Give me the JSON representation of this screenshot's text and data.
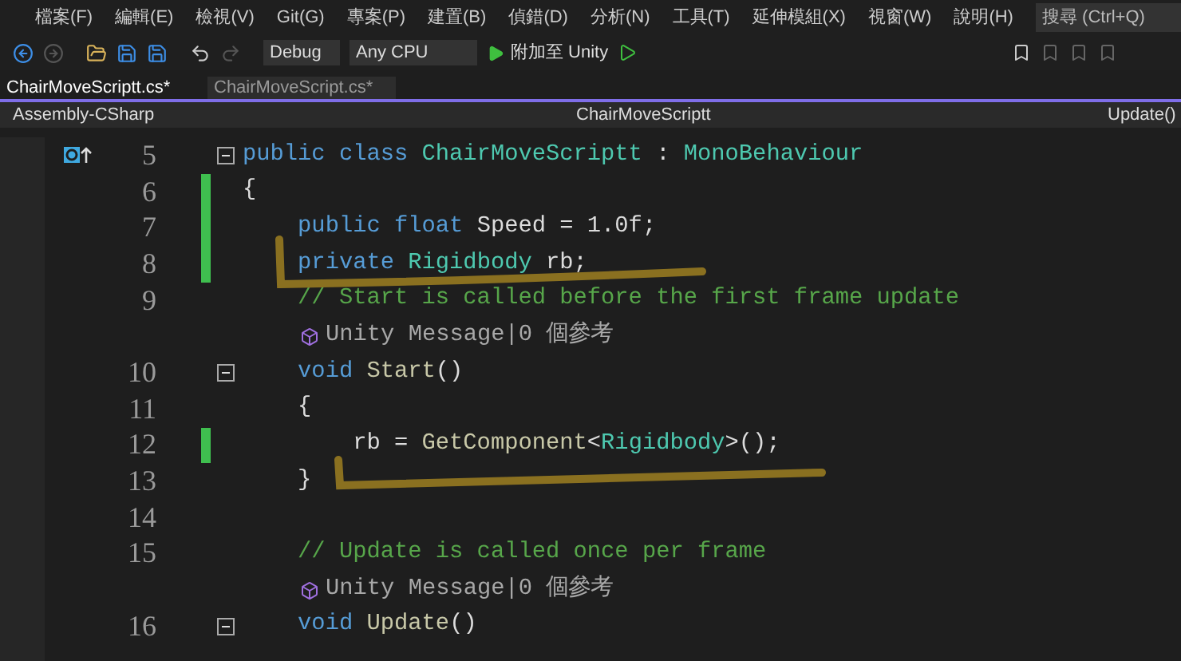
{
  "menu": [
    "檔案(F)",
    "編輯(E)",
    "檢視(V)",
    "Git(G)",
    "專案(P)",
    "建置(B)",
    "偵錯(D)",
    "分析(N)",
    "工具(T)",
    "延伸模組(X)",
    "視窗(W)",
    "說明(H)"
  ],
  "search": {
    "placeholder": "搜尋 (Ctrl+Q)"
  },
  "toolbar": {
    "configuration": "Debug",
    "platform": "Any CPU",
    "attach": "附加至 Unity"
  },
  "tabs": [
    {
      "label": "ChairMoveScriptt.cs*",
      "selected": true
    },
    {
      "label": "ChairMoveScript.cs*",
      "selected": false
    }
  ],
  "navbar": {
    "project": "Assembly-CSharp",
    "type": "ChairMoveScriptt",
    "member": "Update()"
  },
  "lines": [
    {
      "kind": "code",
      "number": "5",
      "changed": false,
      "fold": true,
      "marker": true,
      "tokens": [
        {
          "t": "public class ",
          "kind": "kw"
        },
        {
          "t": "ChairMoveScriptt",
          "kind": "type"
        },
        {
          "t": " : ",
          "kind": "plain"
        },
        {
          "t": "MonoBehaviour",
          "kind": "type"
        }
      ]
    },
    {
      "kind": "code",
      "number": "6",
      "changed": true,
      "fold": false,
      "marker": false,
      "tokens": [
        {
          "t": "{",
          "kind": "plain"
        }
      ]
    },
    {
      "kind": "code",
      "number": "7",
      "changed": true,
      "fold": false,
      "marker": false,
      "tokens": [
        {
          "t": "    public float ",
          "kind": "kw"
        },
        {
          "t": "Speed = 1.0f;",
          "kind": "plain"
        }
      ]
    },
    {
      "kind": "code",
      "number": "8",
      "changed": true,
      "fold": false,
      "marker": false,
      "tokens": [
        {
          "t": "    private ",
          "kind": "kw"
        },
        {
          "t": "Rigidbody",
          "kind": "type"
        },
        {
          "t": " rb;",
          "kind": "plain"
        }
      ]
    },
    {
      "kind": "code",
      "number": "9",
      "changed": false,
      "fold": false,
      "marker": false,
      "tokens": [
        {
          "t": "    // Start is called before the first frame update",
          "kind": "comment"
        }
      ]
    },
    {
      "kind": "lens",
      "text": "Unity Message|0 個參考"
    },
    {
      "kind": "code",
      "number": "10",
      "changed": false,
      "fold": true,
      "marker": false,
      "tokens": [
        {
          "t": "    void ",
          "kind": "kw"
        },
        {
          "t": "Start",
          "kind": "method"
        },
        {
          "t": "()",
          "kind": "plain"
        }
      ]
    },
    {
      "kind": "code",
      "number": "11",
      "changed": false,
      "fold": false,
      "marker": false,
      "tokens": [
        {
          "t": "    {",
          "kind": "plain"
        }
      ]
    },
    {
      "kind": "code",
      "number": "12",
      "changed": true,
      "fold": false,
      "marker": false,
      "tokens": [
        {
          "t": "        rb = ",
          "kind": "plain"
        },
        {
          "t": "GetComponent",
          "kind": "method"
        },
        {
          "t": "<",
          "kind": "plain"
        },
        {
          "t": "Rigidbody",
          "kind": "type"
        },
        {
          "t": ">();",
          "kind": "plain"
        }
      ]
    },
    {
      "kind": "code",
      "number": "13",
      "changed": false,
      "fold": false,
      "marker": false,
      "tokens": [
        {
          "t": "    }",
          "kind": "plain"
        }
      ]
    },
    {
      "kind": "code",
      "number": "14",
      "changed": false,
      "fold": false,
      "marker": false
    },
    {
      "kind": "code",
      "number": "15",
      "changed": false,
      "fold": false,
      "marker": false,
      "tokens": [
        {
          "t": "    // Update is called once per frame",
          "kind": "comment"
        }
      ]
    },
    {
      "kind": "lens",
      "text": "Unity Message|0 個參考"
    },
    {
      "kind": "code",
      "number": "16",
      "changed": false,
      "fold": true,
      "marker": false,
      "tokens": [
        {
          "t": "    void ",
          "kind": "kw"
        },
        {
          "t": "Update",
          "kind": "method"
        },
        {
          "t": "()",
          "kind": "plain"
        }
      ]
    }
  ]
}
